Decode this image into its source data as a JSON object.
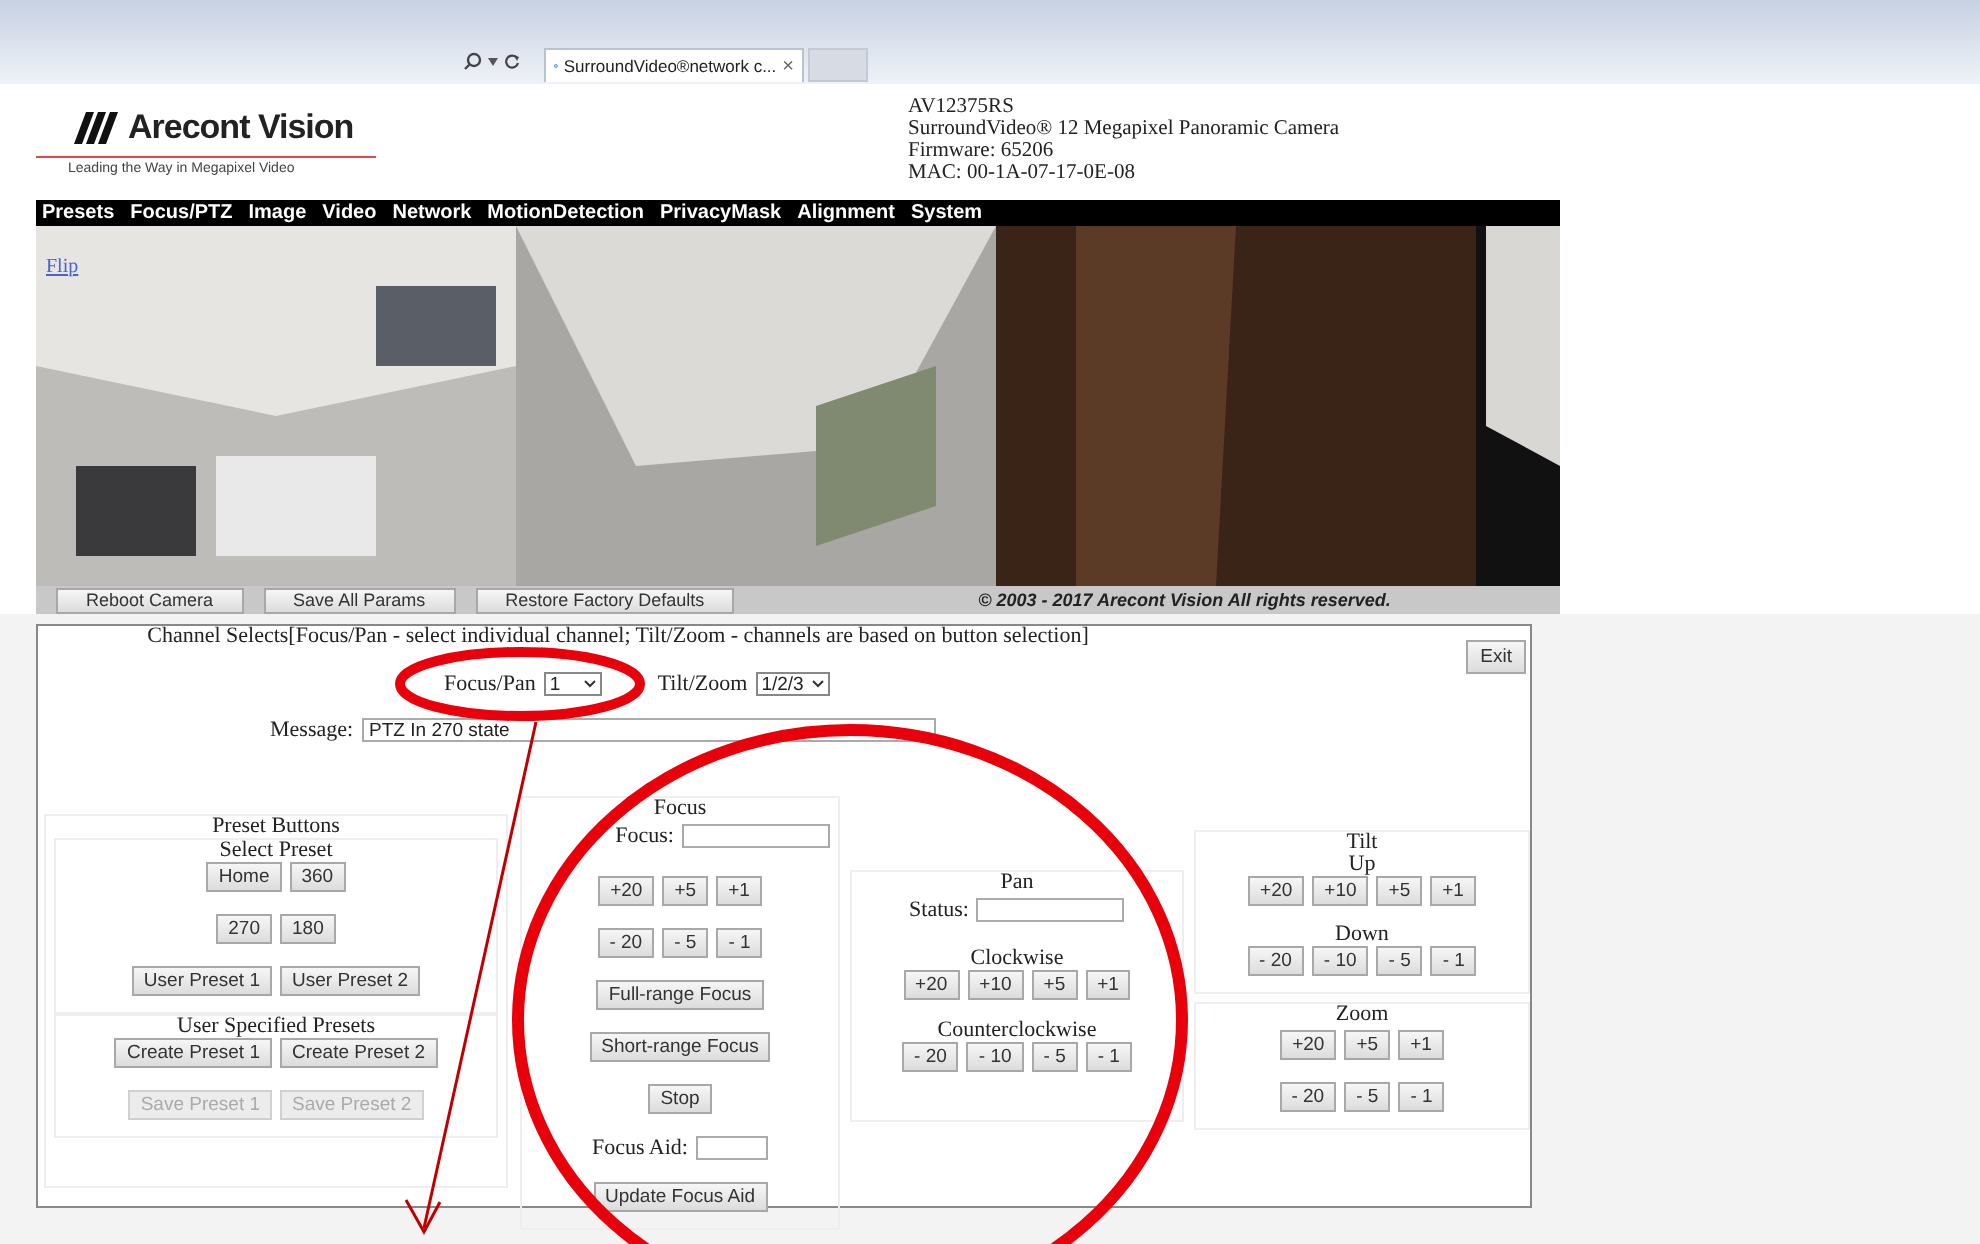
{
  "browser": {
    "tab_title": "SurroundVideo®network c...",
    "tab_close": "×"
  },
  "header": {
    "logo_text": "Arecont Vision",
    "logo_tagline": "Leading the Way in Megapixel Video",
    "device_info": [
      "AV12375RS",
      "SurroundVideo® 12 Megapixel Panoramic Camera",
      "Firmware: 65206",
      "MAC: 00-1A-07-17-0E-08"
    ]
  },
  "menu": [
    "Presets",
    "Focus/PTZ",
    "Image",
    "Video",
    "Network",
    "MotionDetection",
    "PrivacyMask",
    "Alignment",
    "System"
  ],
  "camera_view": {
    "kind": "picture",
    "flip_link": "Flip"
  },
  "action_buttons": [
    "Reboot Camera",
    "Save All Params",
    "Restore Factory Defaults"
  ],
  "copyright": "*© 2003 - 2017* Arecont Vision *All rights reserved.*",
  "channel_select": {
    "heading": "Channel Selects[Focus/Pan - select individual channel; Tilt/Zoom - channels are based on button selection]",
    "focus_pan_label": "Focus/Pan",
    "focus_pan_value": "1",
    "tilt_zoom_label": "Tilt/Zoom",
    "tilt_zoom_value": "1/2/3"
  },
  "exit_button": "Exit",
  "message": {
    "label": "Message:",
    "value": "PTZ In 270 state"
  },
  "presets": {
    "title": "Preset Buttons",
    "select_title": "Select Preset",
    "select_rows": [
      [
        "Home",
        "360"
      ],
      [
        "270",
        "180"
      ],
      [
        "User Preset 1",
        "User Preset 2"
      ]
    ],
    "user_title": "User Specified Presets",
    "user_rows": [
      [
        {
          "label": "Create Preset 1",
          "disabled": false
        },
        {
          "label": "Create Preset 2",
          "disabled": false
        }
      ],
      [
        {
          "label": "Save Preset 1",
          "disabled": true
        },
        {
          "label": "Save Preset 2",
          "disabled": true
        }
      ]
    ]
  },
  "focus": {
    "title": "Focus",
    "field_label": "Focus:",
    "step_rows": [
      [
        "+20",
        "+5",
        "+1"
      ],
      [
        "- 20",
        "- 5",
        "- 1"
      ]
    ],
    "buttons": [
      "Full-range Focus",
      "Short-range Focus",
      "Stop"
    ],
    "aid_label": "Focus Aid:",
    "update_button": "Update Focus Aid"
  },
  "pan": {
    "title": "Pan",
    "status_label": "Status:",
    "groups": [
      {
        "label": "Clockwise",
        "buttons": [
          "+20",
          "+10",
          "+5",
          "+1"
        ]
      },
      {
        "label": "Counterclockwise",
        "buttons": [
          "- 20",
          "- 10",
          "- 5",
          "- 1"
        ]
      }
    ]
  },
  "tilt": {
    "title": "Tilt",
    "groups": [
      {
        "label": "Up",
        "buttons": [
          "+20",
          "+10",
          "+5",
          "+1"
        ]
      },
      {
        "label": "Down",
        "buttons": [
          "- 20",
          "- 10",
          "- 5",
          "- 1"
        ]
      }
    ]
  },
  "zoom": {
    "title": "Zoom",
    "step_rows": [
      [
        "+20",
        "+5",
        "+1"
      ],
      [
        "- 20",
        "- 5",
        "- 1"
      ]
    ]
  }
}
